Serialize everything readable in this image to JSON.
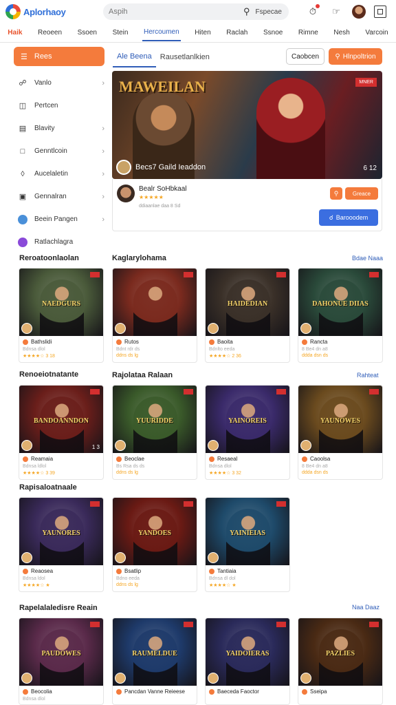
{
  "app": {
    "name": "Aplorhaoy"
  },
  "search": {
    "placeholder": "Aspih",
    "button": "Fspecae"
  },
  "nav": [
    "Haik",
    "Reoeen",
    "Ssoen",
    "Stein",
    "Hercoumen",
    "Hiten",
    "Raclah",
    "Ssnoe",
    "Rimne",
    "Nesh",
    "Varcoin"
  ],
  "sidebar": {
    "main": "Rees",
    "items": [
      {
        "label": "Vanlo",
        "icon": "person-icon",
        "chev": true
      },
      {
        "label": "Pertcen",
        "icon": "card-icon",
        "chev": false
      },
      {
        "label": "Blavity",
        "icon": "doc-icon",
        "chev": true
      },
      {
        "label": "Genntlcoin",
        "icon": "square-icon",
        "chev": true
      },
      {
        "label": "Aucelaletin",
        "icon": "tag-icon",
        "chev": true
      },
      {
        "label": "Gennalran",
        "icon": "box-icon",
        "chev": true
      },
      {
        "label": "Beein Pangen",
        "icon": "blue-dot-icon",
        "chev": true
      },
      {
        "label": "Ratlachlagra",
        "icon": "purple-dot-icon",
        "chev": false
      }
    ]
  },
  "tabs": [
    "Ale Beena",
    "Rausetlanlkien"
  ],
  "toolbar": {
    "secondary": "Caobcen",
    "primary": "Hlnpoltrion"
  },
  "featured": {
    "title": "MAWEILAN",
    "badge": "MNER",
    "caption": "Becs7 Gaild Ieaddon",
    "count": "6 12",
    "author": "Bealr SoHbkaal",
    "stars": "★★★★★",
    "sub": "ddiaanlae daa 8 Sd",
    "btn_small": "Greace",
    "btn_primary": "Barooodem"
  },
  "sections": [
    {
      "title": "Reroatoonlaolan",
      "sub_title": "Kaglarylohama",
      "more": "Bdae Naaa"
    },
    {
      "title": "Renoeiotnatante",
      "sub_title": "Rajolataa Ralaan",
      "more": "Rahteat"
    },
    {
      "title": "Rapisaloatnaale",
      "sub_title": "",
      "more": ""
    },
    {
      "title": "Rapelalaledisre Reain",
      "sub_title": "",
      "more": "Naa Daaz"
    }
  ],
  "cards": [
    {
      "title": "NAEDGURS",
      "name": "Bathslidi",
      "sub": "Bdnsa dlol",
      "stars": "★★★★☆ 3 18",
      "num": "",
      "color": "#4a5a3a"
    },
    {
      "title": "",
      "name": "Rutos",
      "sub": "Bdnt rdr ds",
      "stars": "ddns ds lg",
      "num": "",
      "color": "#7a2a1e"
    },
    {
      "title": "HAIDEDIAN",
      "name": "Baoita",
      "sub": "Bdnlto eeda",
      "stars": "★★★★☆ 2 36",
      "num": "",
      "color": "#3a3028"
    },
    {
      "title": "DAHONUE DIIAS",
      "name": "Rancta",
      "sub": "8 Be4 dn a8",
      "stars": "ddda dsn ds",
      "num": "",
      "color": "#2a4a3a"
    },
    {
      "title": "BANDOANNDON",
      "name": "Reamaia",
      "sub": "Bdnsa ldlol",
      "stars": "★★★★☆ 3 39",
      "num": "1 3",
      "color": "#6a1e1a"
    },
    {
      "title": "YUURIDDE",
      "name": "Beoclae",
      "sub": "Bs Rsa ds ds",
      "stars": "ddns ds lg",
      "num": "",
      "color": "#3a5a2a"
    },
    {
      "title": "YAINOREIS",
      "name": "Resaeal",
      "sub": "Bdnsa dlol",
      "stars": "★★★★☆ 3 32",
      "num": "",
      "color": "#3a2a6a"
    },
    {
      "title": "YAUNOWES",
      "name": "Caoolsa",
      "sub": "8 Be4 dn a8",
      "stars": "ddda dsn ds",
      "num": "",
      "color": "#6a4a1e"
    },
    {
      "title": "YAUNORES",
      "name": "Reaosea",
      "sub": "Bdnsa ldol",
      "stars": "★★★★☆ ★",
      "num": "",
      "color": "#3a2a5a"
    },
    {
      "title": "YANDOES",
      "name": "Bsatlip",
      "sub": "Bdno eeda",
      "stars": "ddns ds lg",
      "num": "",
      "color": "#6a1a14"
    },
    {
      "title": "YAINIEIAS",
      "name": "Tantiaia",
      "sub": "Bdnsa dl dol",
      "stars": "★★★★☆ ★",
      "num": "",
      "color": "#1e4a6a"
    },
    {
      "title": "PAUDOWES",
      "name": "Beocolia",
      "sub": "Bdnsa dlol",
      "stars": "",
      "num": "",
      "color": "#5a2a4a"
    },
    {
      "title": "RAUMELDUE",
      "name": "Pancdan Vanne Reieese",
      "sub": "",
      "stars": "",
      "num": "",
      "color": "#1e3a6a"
    },
    {
      "title": "YAIDOIERAS",
      "name": "Baeceda Faoctor",
      "sub": "",
      "stars": "",
      "num": "",
      "color": "#2a2a5a"
    },
    {
      "title": "PAZLIES",
      "name": "Sseipa",
      "sub": "",
      "stars": "",
      "num": "",
      "color": "#4a2a14"
    }
  ],
  "colors": {
    "accent": "#f47b3c",
    "primary": "#3b6ee0",
    "link": "#2f5db8"
  }
}
